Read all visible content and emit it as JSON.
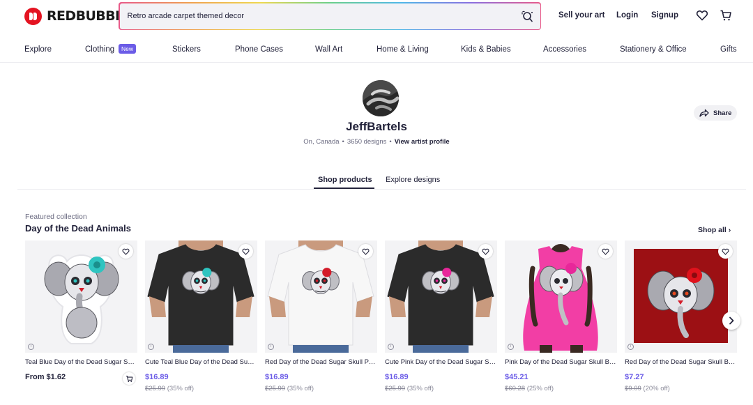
{
  "brand": {
    "name": "REDBUBBLE",
    "color": "#e41321"
  },
  "search": {
    "value": "Retro arcade carpet themed decor"
  },
  "header": {
    "sell_label": "Sell your art",
    "login_label": "Login",
    "signup_label": "Signup",
    "icons": [
      "heart-icon",
      "cart-icon"
    ]
  },
  "nav": {
    "items": [
      "Explore",
      "Clothing",
      "Stickers",
      "Phone Cases",
      "Wall Art",
      "Home & Living",
      "Kids & Babies",
      "Accessories",
      "Stationery & Office",
      "Gifts"
    ],
    "new_badge": "New"
  },
  "artist": {
    "name": "JeffBartels",
    "location": "On, Canada",
    "designs": "3650 designs",
    "profile_link": "View artist profile",
    "share_label": "Share"
  },
  "tabs": {
    "shop": "Shop products",
    "explore": "Explore designs"
  },
  "collection": {
    "kicker": "Featured collection",
    "title": "Day of the Dead Animals",
    "shop_all": "Shop all",
    "accent_color": "#6b5ce7",
    "products": [
      {
        "title": "Teal Blue Day of the Dead Sugar Skull Baby Elephant",
        "price": "From $1.62",
        "original": "",
        "discount": "",
        "shirt": "sticker",
        "flower": "#2ec4c0"
      },
      {
        "title": "Cute Teal Blue Day of the Dead Sugar Skull Bear",
        "price": "$16.89",
        "original": "$25.99",
        "discount": "(35% off)",
        "shirt": "#2b2b2b",
        "flower": "#2ec4c0"
      },
      {
        "title": "Red Day of the Dead Sugar Skull Panda",
        "price": "$16.89",
        "original": "$25.99",
        "discount": "(35% off)",
        "shirt": "#f7f7f7",
        "flower": "#d31c2a"
      },
      {
        "title": "Cute Pink Day of the Dead Sugar Skull Bear",
        "price": "$16.89",
        "original": "$25.99",
        "discount": "(35% off)",
        "shirt": "#2b2b2b",
        "flower": "#e8279a"
      },
      {
        "title": "Pink Day of the Dead Sugar Skull Baby Elephant",
        "price": "$45.21",
        "original": "$60.28",
        "discount": "(25% off)",
        "shirt": "#f23ea5",
        "flower": "#e8279a"
      },
      {
        "title": "Red Day of the Dead Sugar Skull Baby Elephant",
        "price": "$7.27",
        "original": "$9.09",
        "discount": "(20% off)",
        "shirt": "print",
        "flower": "#d31c2a"
      }
    ]
  }
}
